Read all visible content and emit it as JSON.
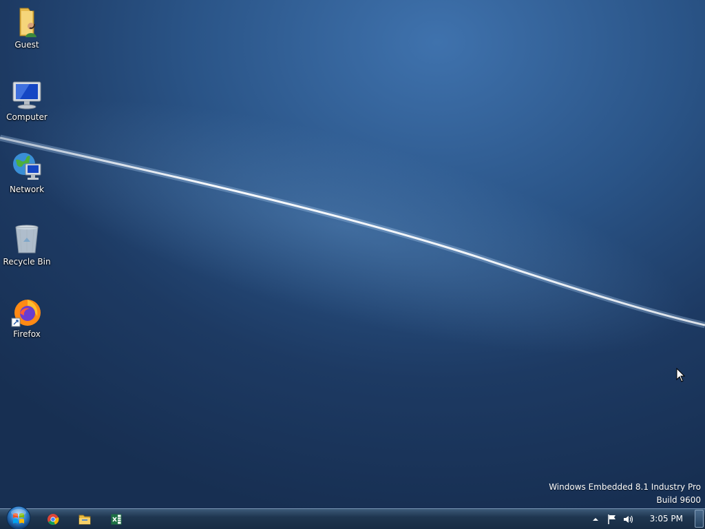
{
  "desktop": {
    "icons": [
      {
        "label": "Guest",
        "icon": "user-folder-icon"
      },
      {
        "label": "Computer",
        "icon": "computer-icon"
      },
      {
        "label": "Network",
        "icon": "network-icon"
      },
      {
        "label": "Recycle Bin",
        "icon": "recycle-bin-icon"
      },
      {
        "label": "Firefox",
        "icon": "firefox-icon"
      }
    ]
  },
  "watermark": {
    "line1": "Windows Embedded 8.1 Industry Pro",
    "line2": "Build 9600"
  },
  "taskbar": {
    "start_icon": "windows-start-icon",
    "pinned": [
      {
        "icon": "chrome-icon"
      },
      {
        "icon": "file-explorer-icon"
      },
      {
        "icon": "excel-icon"
      }
    ],
    "tray": {
      "clock": "3:05 PM"
    }
  },
  "colors": {
    "desktop_top": "#3f72ad",
    "desktop_bottom": "#172f52",
    "taskbar": "#1f3650"
  }
}
